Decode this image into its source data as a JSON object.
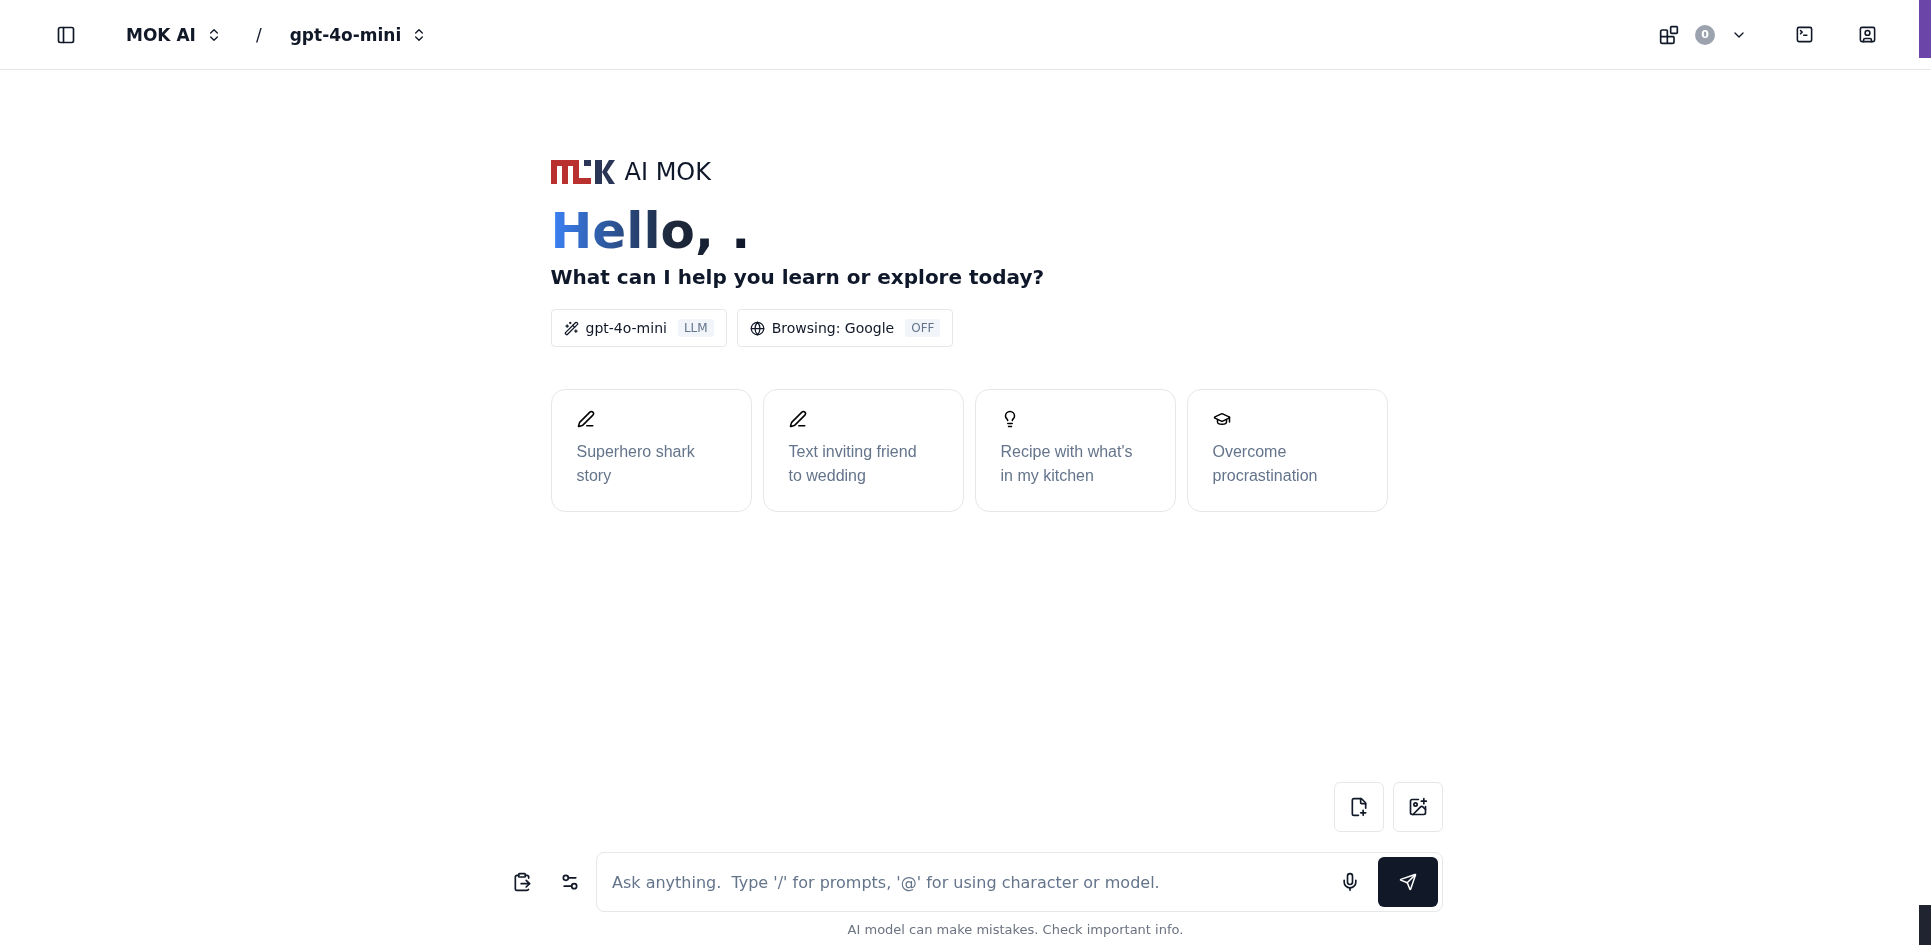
{
  "header": {
    "workspace": "MOK AI",
    "separator": "/",
    "model": "gpt-4o-mini",
    "count": "0"
  },
  "brand": {
    "name": "AI MOK"
  },
  "greeting": {
    "hello": "Hello, .",
    "subtitle": "What can I help you learn or explore today?"
  },
  "chips": [
    {
      "kind": "model",
      "label": "gpt-4o-mini",
      "tag": "LLM"
    },
    {
      "kind": "browsing",
      "label": "Browsing: Google",
      "tag": "OFF"
    }
  ],
  "suggestions": [
    {
      "kind": "write",
      "text": "Superhero shark story"
    },
    {
      "kind": "write",
      "text": "Text inviting friend to wedding"
    },
    {
      "kind": "idea",
      "text": "Recipe with what's in my kitchen"
    },
    {
      "kind": "learn",
      "text": "Overcome procrastination"
    }
  ],
  "composer": {
    "placeholder": "Ask anything.  Type '/' for prompts, '@' for using character or model.",
    "disclaimer": "AI model can make mistakes. Check important info."
  }
}
